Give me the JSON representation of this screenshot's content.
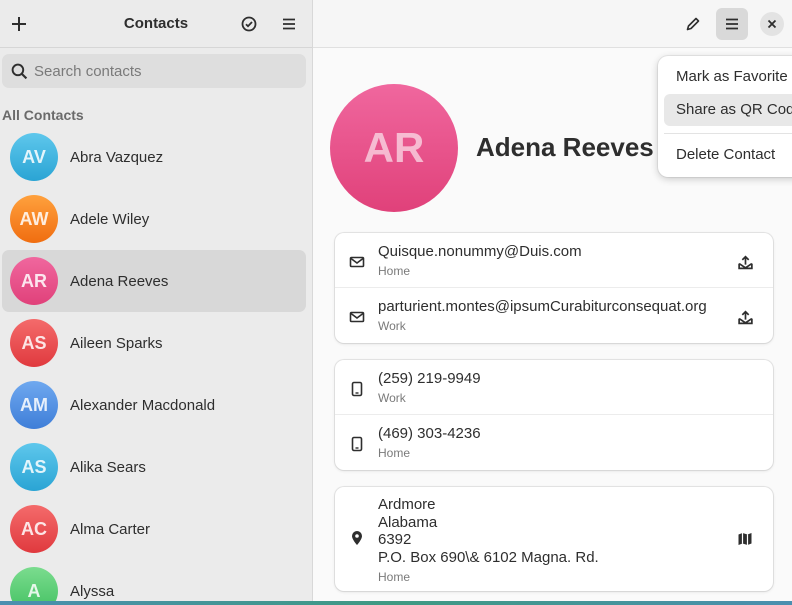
{
  "sidebar": {
    "title": "Contacts",
    "search_placeholder": "Search contacts",
    "section_label": "All Contacts",
    "contacts": [
      {
        "initials": "AV",
        "name": "Abra Vazquez",
        "color_top": "#5ec7ec",
        "color_bottom": "#2aa4d4",
        "selected": false
      },
      {
        "initials": "AW",
        "name": "Adele Wiley",
        "color_top": "#ffa13d",
        "color_bottom": "#f06d10",
        "selected": false
      },
      {
        "initials": "AR",
        "name": "Adena Reeves",
        "color_top": "#f0679e",
        "color_bottom": "#e0417a",
        "selected": true
      },
      {
        "initials": "AS",
        "name": "Aileen Sparks",
        "color_top": "#f46b6b",
        "color_bottom": "#e0393e",
        "selected": false
      },
      {
        "initials": "AM",
        "name": "Alexander Macdonald",
        "color_top": "#6fa8ef",
        "color_bottom": "#3f7ed8",
        "selected": false
      },
      {
        "initials": "AS",
        "name": "Alika Sears",
        "color_top": "#5ec7ec",
        "color_bottom": "#2aa4d4",
        "selected": false
      },
      {
        "initials": "AC",
        "name": "Alma Carter",
        "color_top": "#f46b6b",
        "color_bottom": "#e0393e",
        "selected": false
      },
      {
        "initials": "A",
        "name": "Alyssa",
        "color_top": "#7bdc8f",
        "color_bottom": "#3fbf5e",
        "selected": false
      }
    ]
  },
  "contact": {
    "initials": "AR",
    "name": "Adena Reeves",
    "emails": [
      {
        "value": "Quisque.nonummy@Duis.com",
        "label": "Home"
      },
      {
        "value": "parturient.montes@ipsumCurabiturconsequat.org",
        "label": "Work"
      }
    ],
    "phones": [
      {
        "value": "(259) 219-9949",
        "label": "Work"
      },
      {
        "value": "(469) 303-4236",
        "label": "Home"
      }
    ],
    "address": {
      "lines": [
        "Ardmore",
        "Alabama",
        "6392",
        "P.O. Box 690\\& 6102 Magna. Rd."
      ],
      "label": "Home"
    }
  },
  "menu": {
    "items": [
      "Mark as Favorite",
      "Share as QR Code",
      "Delete Contact"
    ]
  },
  "icons": {
    "add": "plus-icon",
    "select": "check-circle-icon",
    "sidebar_menu": "hamburger-icon",
    "edit": "pencil-icon",
    "main_menu": "hamburger-icon",
    "close": "close-icon"
  }
}
